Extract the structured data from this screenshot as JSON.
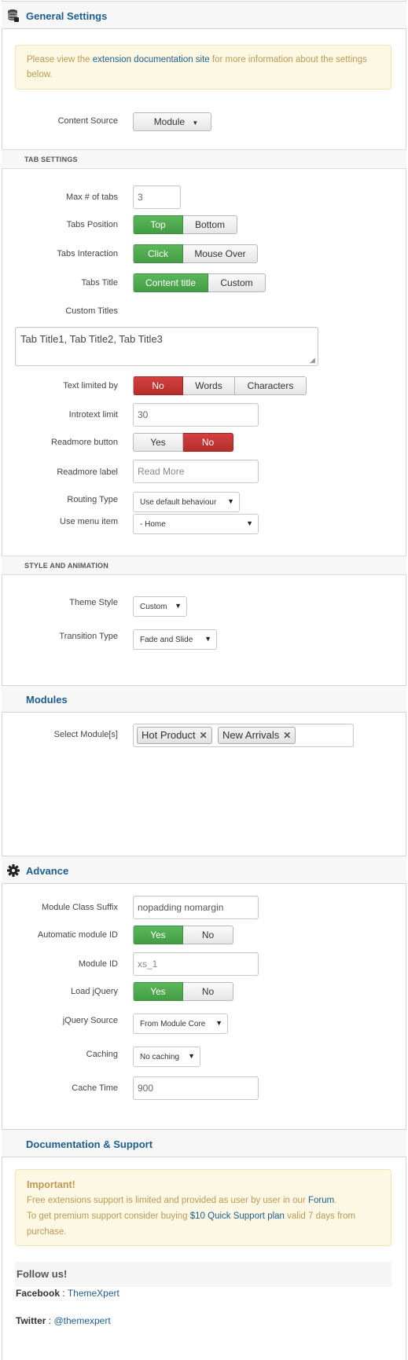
{
  "general": {
    "title": "General Settings",
    "notice_before": "Please view the ",
    "notice_link": "extension documentation site",
    "notice_after": " for more information about the settings below.",
    "content_source_label": "Content Source",
    "content_source_value": "Module"
  },
  "tab_settings": {
    "title": "TAB SETTINGS",
    "max_tabs_label": "Max # of tabs",
    "max_tabs_value": "3",
    "position_label": "Tabs Position",
    "position_options": [
      "Top",
      "Bottom"
    ],
    "interaction_label": "Tabs Interaction",
    "interaction_options": [
      "Click",
      "Mouse Over"
    ],
    "title_label": "Tabs Title",
    "title_options": [
      "Content title",
      "Custom"
    ],
    "custom_titles_label": "Custom Titles",
    "custom_titles_value": "Tab Title1, Tab Title2, Tab Title3",
    "text_limited_label": "Text limited by",
    "text_limited_options": [
      "No",
      "Words",
      "Characters"
    ],
    "introtext_label": "Introtext limit",
    "introtext_value": "30",
    "readmore_button_label": "Readmore button",
    "readmore_button_options": [
      "Yes",
      "No"
    ],
    "readmore_label_label": "Readmore label",
    "readmore_label_placeholder": "Read More",
    "routing_label": "Routing Type",
    "routing_value": "Use default behaviour",
    "menu_item_label": "Use menu item",
    "menu_item_value": "- Home"
  },
  "style": {
    "title": "STYLE AND ANIMATION",
    "theme_label": "Theme Style",
    "theme_value": "Custom",
    "transition_label": "Transition Type",
    "transition_value": "Fade and Slide"
  },
  "modules": {
    "title": "Modules",
    "select_label": "Select Module[s]",
    "selected": [
      "Hot Product",
      "New Arrivals"
    ]
  },
  "advance": {
    "title": "Advance",
    "suffix_label": "Module Class Suffix",
    "suffix_value": "nopadding nomargin",
    "auto_id_label": "Automatic module ID",
    "auto_id_options": [
      "Yes",
      "No"
    ],
    "module_id_label": "Module ID",
    "module_id_placeholder": "xs_1",
    "jquery_label": "Load jQuery",
    "jquery_options": [
      "Yes",
      "No"
    ],
    "jquery_source_label": "jQuery Source",
    "jquery_source_value": "From Module Core",
    "caching_label": "Caching",
    "caching_value": "No caching",
    "cache_time_label": "Cache Time",
    "cache_time_value": "900"
  },
  "support": {
    "title": "Documentation & Support",
    "important": "Important!",
    "line1_before": "Free extensions support is limited and provided as user by user in our ",
    "line1_link": "Forum",
    "line1_after": ".",
    "line2_before": "To get premium support consider buying ",
    "line2_link": "$10 Quick Support plan",
    "line2_after": " valid 7 days from purchase.",
    "follow_title": "Follow us!",
    "facebook_label": "Facebook",
    "facebook_link": "ThemeXpert",
    "twitter_label": "Twitter",
    "twitter_link": "@themexpert"
  },
  "colors": {
    "heading": "#1e5e8c",
    "active_green": "#4cae4c",
    "active_red": "#c9302c",
    "notice_bg": "#fcf8e3",
    "notice_text": "#c09853"
  },
  "icons": {
    "general": "database-icon",
    "advance": "gear-icon"
  }
}
